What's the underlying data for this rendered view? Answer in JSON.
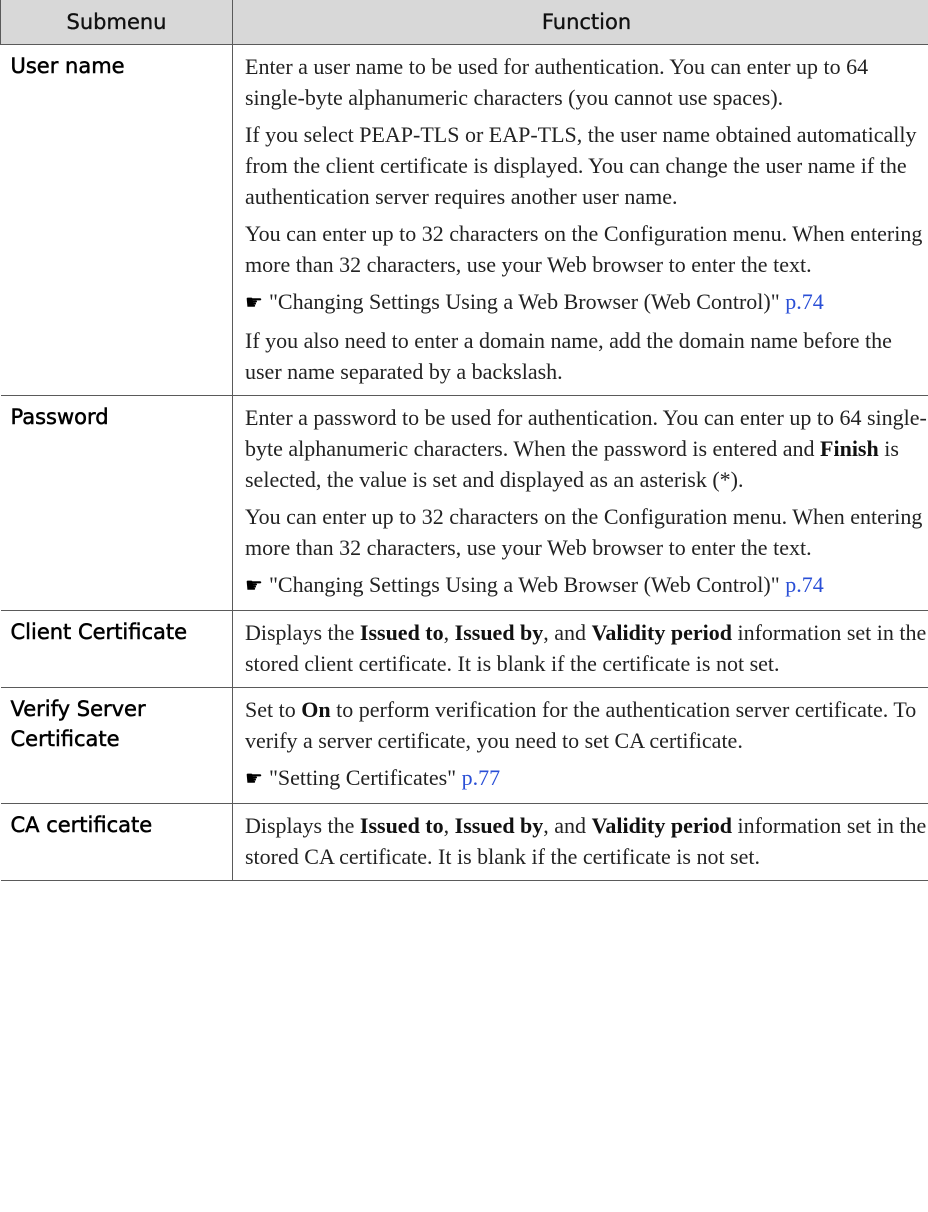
{
  "header": {
    "submenu": "Submenu",
    "function": "Function"
  },
  "rows": [
    {
      "submenu": "User name",
      "paragraphs": [
        [
          {
            "t": "Enter a user name to be used for authentication. You can enter up to 64 single-byte alphanumeric characters (you cannot use spaces)."
          }
        ],
        [
          {
            "t": "If you select PEAP-TLS or EAP-TLS, the user name obtained automatically from the client certificate is displayed. You can change the user name if the authentication server requires another user name."
          }
        ],
        [
          {
            "t": "You can enter up to 32 characters on the Configuration menu. When entering more than 32 characters, use your Web browser to enter the text."
          }
        ],
        [
          {
            "icon": "pointing-hand-icon",
            "glyph": "☛"
          },
          {
            "t": "\"Changing Settings Using a Web Browser (Web Control)\" "
          },
          {
            "link": "p.74"
          }
        ],
        [
          {
            "t": "If you also need to enter a domain name, add the domain name before the user name separated by a backslash."
          }
        ]
      ]
    },
    {
      "submenu": "Password",
      "paragraphs": [
        [
          {
            "t": "Enter a password to be used for authentication. You can enter up to 64 single-byte alphanumeric characters. When the password is entered and "
          },
          {
            "b": "Finish"
          },
          {
            "t": " is selected, the value is set and displayed as an asterisk (*)."
          }
        ],
        [
          {
            "t": "You can enter up to 32 characters on the Configuration menu. When entering more than 32 characters, use your Web browser to enter the text."
          }
        ],
        [
          {
            "icon": "pointing-hand-icon",
            "glyph": "☛"
          },
          {
            "t": "\"Changing Settings Using a Web Browser (Web Control)\" "
          },
          {
            "link": "p.74"
          }
        ]
      ]
    },
    {
      "submenu": "Client Certificate",
      "paragraphs": [
        [
          {
            "t": "Displays the "
          },
          {
            "b": "Issued to"
          },
          {
            "t": ", "
          },
          {
            "b": "Issued by"
          },
          {
            "t": ", and "
          },
          {
            "b": "Validity period"
          },
          {
            "t": " information set in the stored client certificate. It is blank if the certificate is not set."
          }
        ]
      ]
    },
    {
      "submenu": "Verify Server Certificate",
      "paragraphs": [
        [
          {
            "t": "Set to "
          },
          {
            "b": "On"
          },
          {
            "t": " to perform verification for the authentication server certificate. To verify a server certificate, you need to set CA certificate."
          }
        ],
        [
          {
            "icon": "pointing-hand-icon",
            "glyph": "☛"
          },
          {
            "t": "\"Setting Certificates\" "
          },
          {
            "link": "p.77"
          }
        ]
      ]
    },
    {
      "submenu": "CA certificate",
      "paragraphs": [
        [
          {
            "t": "Displays the "
          },
          {
            "b": "Issued to"
          },
          {
            "t": ", "
          },
          {
            "b": "Issued by"
          },
          {
            "t": ", and "
          },
          {
            "b": "Validity period"
          },
          {
            "t": " information set in the stored CA certificate. It is blank if the certificate is not set."
          }
        ]
      ]
    }
  ]
}
